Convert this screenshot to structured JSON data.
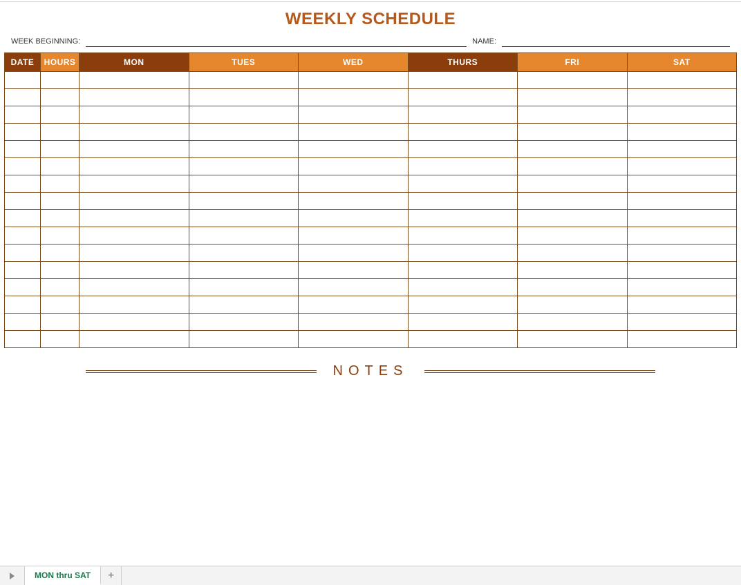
{
  "title": "WEEKLY SCHEDULE",
  "meta": {
    "week_beginning_label": "WEEK BEGINNING:",
    "week_beginning_value": "",
    "name_label": "NAME:",
    "name_value": ""
  },
  "headers": {
    "date": "DATE",
    "hours": "HOURS",
    "days": [
      "MON",
      "TUES",
      "WED",
      "THURS",
      "FRI",
      "SAT"
    ]
  },
  "rows": [
    {
      "date": "",
      "hours": "",
      "mon": "",
      "tues": "",
      "wed": "",
      "thurs": "",
      "fri": "",
      "sat": ""
    },
    {
      "date": "",
      "hours": "",
      "mon": "",
      "tues": "",
      "wed": "",
      "thurs": "",
      "fri": "",
      "sat": ""
    },
    {
      "date": "",
      "hours": "",
      "mon": "",
      "tues": "",
      "wed": "",
      "thurs": "",
      "fri": "",
      "sat": ""
    },
    {
      "date": "",
      "hours": "",
      "mon": "",
      "tues": "",
      "wed": "",
      "thurs": "",
      "fri": "",
      "sat": ""
    },
    {
      "date": "",
      "hours": "",
      "mon": "",
      "tues": "",
      "wed": "",
      "thurs": "",
      "fri": "",
      "sat": ""
    },
    {
      "date": "",
      "hours": "",
      "mon": "",
      "tues": "",
      "wed": "",
      "thurs": "",
      "fri": "",
      "sat": ""
    },
    {
      "date": "",
      "hours": "",
      "mon": "",
      "tues": "",
      "wed": "",
      "thurs": "",
      "fri": "",
      "sat": ""
    },
    {
      "date": "",
      "hours": "",
      "mon": "",
      "tues": "",
      "wed": "",
      "thurs": "",
      "fri": "",
      "sat": ""
    },
    {
      "date": "",
      "hours": "",
      "mon": "",
      "tues": "",
      "wed": "",
      "thurs": "",
      "fri": "",
      "sat": ""
    },
    {
      "date": "",
      "hours": "",
      "mon": "",
      "tues": "",
      "wed": "",
      "thurs": "",
      "fri": "",
      "sat": ""
    },
    {
      "date": "",
      "hours": "",
      "mon": "",
      "tues": "",
      "wed": "",
      "thurs": "",
      "fri": "",
      "sat": ""
    },
    {
      "date": "",
      "hours": "",
      "mon": "",
      "tues": "",
      "wed": "",
      "thurs": "",
      "fri": "",
      "sat": ""
    },
    {
      "date": "",
      "hours": "",
      "mon": "",
      "tues": "",
      "wed": "",
      "thurs": "",
      "fri": "",
      "sat": ""
    },
    {
      "date": "",
      "hours": "",
      "mon": "",
      "tues": "",
      "wed": "",
      "thurs": "",
      "fri": "",
      "sat": ""
    },
    {
      "date": "",
      "hours": "",
      "mon": "",
      "tues": "",
      "wed": "",
      "thurs": "",
      "fri": "",
      "sat": ""
    },
    {
      "date": "",
      "hours": "",
      "mon": "",
      "tues": "",
      "wed": "",
      "thurs": "",
      "fri": "",
      "sat": ""
    }
  ],
  "notes_label": "NOTES",
  "tabs": {
    "active": "MON thru SAT"
  },
  "colors": {
    "header_dark": "#8B3E0B",
    "header_light": "#E6872D",
    "border": "#7a4a1a",
    "title": "#B55A1C"
  }
}
